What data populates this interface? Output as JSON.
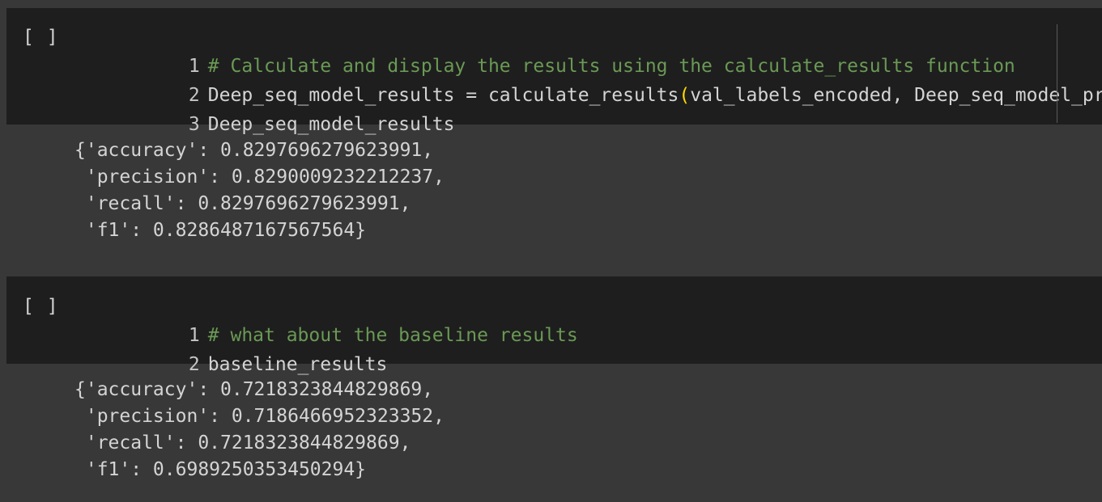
{
  "cells": [
    {
      "run_label": "[ ]",
      "code": {
        "line1": {
          "no": "1",
          "comment": "# Calculate and display the results using the calculate_results function"
        },
        "line2": {
          "no": "2",
          "before": "Deep_seq_model_results = calculate_results",
          "open": "(",
          "args": "val_labels_encoded, Deep_seq_model_pred",
          "close": ")"
        },
        "line3": {
          "no": "3",
          "text": "Deep_seq_model_results"
        }
      },
      "output": [
        "{'accuracy': 0.8297696279623991,",
        " 'precision': 0.8290009232212237,",
        " 'recall': 0.8297696279623991,",
        " 'f1': 0.8286487167567564}"
      ]
    },
    {
      "run_label": "[ ]",
      "code": {
        "line1": {
          "no": "1",
          "comment": "# what about the baseline results"
        },
        "line2": {
          "no": "2",
          "text": "baseline_results"
        }
      },
      "output": [
        "{'accuracy': 0.7218323844829869,",
        " 'precision': 0.7186466952323352,",
        " 'recall': 0.7218323844829869,",
        " 'f1': 0.6989250353450294}"
      ]
    }
  ]
}
